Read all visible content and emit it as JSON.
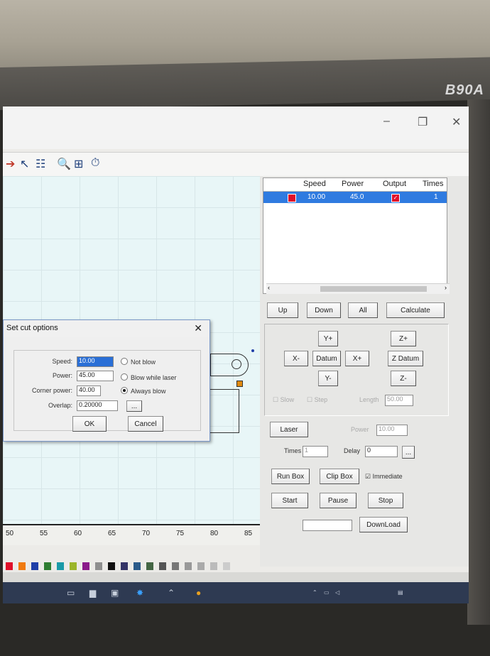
{
  "monitor": {
    "brand": "B90A"
  },
  "window": {
    "minimize_glyph": "–",
    "restore_glyph": "❐",
    "close_glyph": "✕"
  },
  "toolbar": {
    "icons": [
      "arrow-icon",
      "node-edit-icon",
      "grid-icon",
      "preview-icon",
      "scale-icon",
      "timer-icon"
    ]
  },
  "ruler": {
    "ticks": [
      "50",
      "55",
      "60",
      "65",
      "70",
      "75",
      "80",
      "85"
    ]
  },
  "layers": {
    "headers": {
      "speed": "Speed",
      "power": "Power",
      "output": "Output",
      "times": "Times"
    },
    "rows": [
      {
        "color": "#e0102a",
        "speed": "10.00",
        "power": "45.0",
        "output": true,
        "times": "1"
      }
    ]
  },
  "layer_buttons": {
    "up": "Up",
    "down": "Down",
    "all": "All",
    "calculate": "Calculate"
  },
  "move": {
    "y_plus": "Y+",
    "x_minus": "X-",
    "datum": "Datum",
    "x_plus": "X+",
    "y_minus": "Y-",
    "z_plus": "Z+",
    "z_datum": "Z Datum",
    "z_minus": "Z-",
    "slow": "Slow",
    "step": "Step",
    "length_label": "Length",
    "length_value": "50.00"
  },
  "laser": {
    "button": "Laser",
    "power_label": "Power",
    "power_value": "10.00"
  },
  "timing": {
    "times_label": "Times",
    "times_value": "1",
    "delay_label": "Delay",
    "delay_value": "0",
    "more": "..."
  },
  "box": {
    "run_box": "Run Box",
    "clip_box": "Clip Box",
    "immediate": "Immediate",
    "immediate_checked": true
  },
  "control": {
    "start": "Start",
    "pause": "Pause",
    "stop": "Stop",
    "download": "DownLoad"
  },
  "dialog": {
    "title": "Set cut options",
    "close": "✕",
    "speed_label": "Speed:",
    "speed_value": "10.00",
    "power_label": "Power:",
    "power_value": "45.00",
    "corner_power_label": "Corner power:",
    "corner_power_value": "40.00",
    "overlap_label": "Overlap:",
    "overlap_value": "0.20000",
    "more_button": "...",
    "blow_options": [
      "Not blow",
      "Blow while laser",
      "Always blow"
    ],
    "blow_selected": 2,
    "ok": "OK",
    "cancel": "Cancel"
  },
  "palette": [
    "#e0102a",
    "#f07a10",
    "#1f3fa8",
    "#2e7d32",
    "#1a9aa8",
    "#9bb52a",
    "#8a1a8a",
    "#8f8f8f",
    "#111111",
    "#333366",
    "#2b5b8a",
    "#446644",
    "#555555",
    "#777777",
    "#999999",
    "#aaaaaa",
    "#bbbbbb",
    "#cccccc"
  ]
}
